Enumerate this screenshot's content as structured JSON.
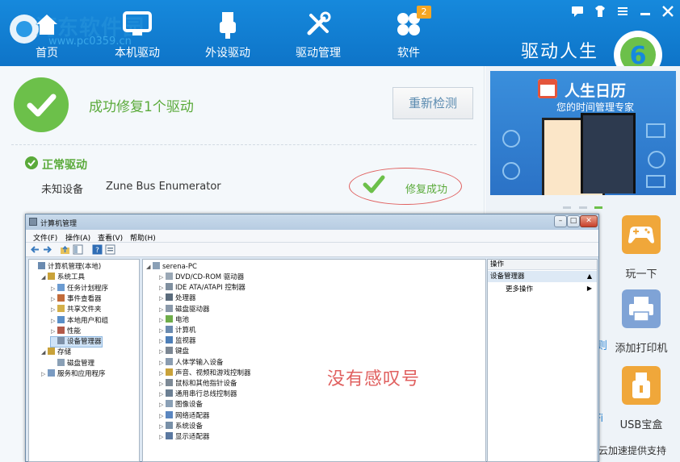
{
  "header": {
    "watermark": "河东软件园",
    "watermark_url": "www.pc0359.cn",
    "nav": [
      {
        "label": "首页"
      },
      {
        "label": "本机驱动"
      },
      {
        "label": "外设驱动"
      },
      {
        "label": "驱动管理"
      },
      {
        "label": "软件",
        "badge": "2"
      }
    ],
    "brand": "驱动人生",
    "brand_version": "6"
  },
  "main": {
    "success_message": "成功修复1个驱动",
    "rescan_button": "重新检测",
    "section_title": "正常驱动",
    "device": {
      "type": "未知设备",
      "name": "Zune Bus Enumerator",
      "status": "修复成功"
    }
  },
  "sidebar": {
    "ad": {
      "title": "人生日历",
      "subtitle": "您的时间管理专家"
    },
    "tools": [
      {
        "label": "玩一下",
        "icon": "gamepad-icon"
      },
      {
        "label": "添加打印机",
        "icon": "printer-icon"
      },
      {
        "label": "USB宝盒",
        "icon": "usb-icon"
      }
    ],
    "stray_chars": [
      "则",
      "Fi"
    ],
    "footer": "云加速提供支持"
  },
  "computer_management": {
    "title": "计算机管理",
    "menus": [
      "文件(F)",
      "操作(A)",
      "查看(V)",
      "帮助(H)"
    ],
    "tree": [
      {
        "label": "计算机管理(本地)",
        "level": 0,
        "expander": ""
      },
      {
        "label": "系统工具",
        "level": 1,
        "expander": "◢"
      },
      {
        "label": "任务计划程序",
        "level": 2,
        "expander": "▷"
      },
      {
        "label": "事件查看器",
        "level": 2,
        "expander": "▷"
      },
      {
        "label": "共享文件夹",
        "level": 2,
        "expander": "▷"
      },
      {
        "label": "本地用户和组",
        "level": 2,
        "expander": "▷"
      },
      {
        "label": "性能",
        "level": 2,
        "expander": "▷"
      },
      {
        "label": "设备管理器",
        "level": 2,
        "expander": "",
        "selected": true
      },
      {
        "label": "存储",
        "level": 1,
        "expander": "◢"
      },
      {
        "label": "磁盘管理",
        "level": 2,
        "expander": ""
      },
      {
        "label": "服务和应用程序",
        "level": 1,
        "expander": "▷"
      }
    ],
    "device_list": {
      "root": "serena-PC",
      "items": [
        "DVD/CD-ROM 驱动器",
        "IDE ATA/ATAPI 控制器",
        "处理器",
        "磁盘驱动器",
        "电池",
        "计算机",
        "监视器",
        "键盘",
        "人体学输入设备",
        "声音、视频和游戏控制器",
        "鼠标和其他指针设备",
        "通用串行总线控制器",
        "图像设备",
        "网络适配器",
        "系统设备",
        "显示适配器"
      ]
    },
    "actions": {
      "header": "操作",
      "section": "设备管理器",
      "more": "更多操作"
    },
    "annotation": "没有感叹号"
  },
  "colors": {
    "brand_blue": "#1689dc",
    "success_green": "#6cc04a",
    "annotation_red": "#e0605f"
  }
}
